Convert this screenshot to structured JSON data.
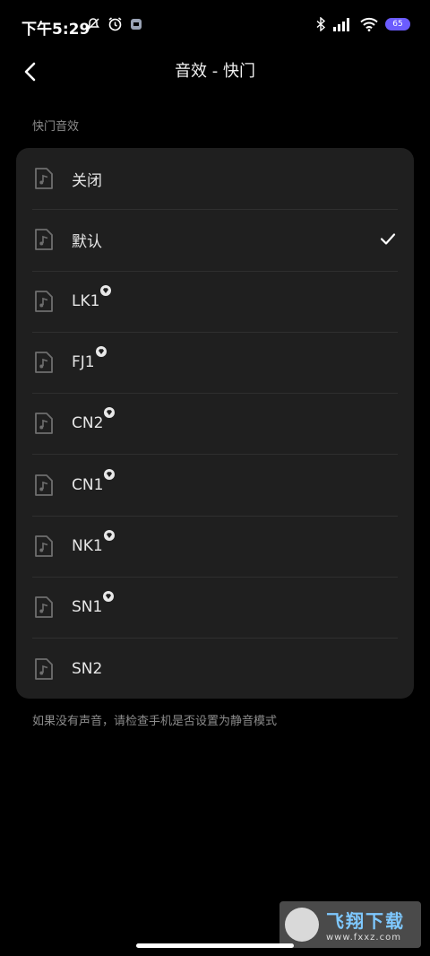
{
  "status_bar": {
    "time": "下午5:29",
    "battery": "65"
  },
  "header": {
    "title": "音效 - 快门"
  },
  "section_label": "快门音效",
  "options": [
    {
      "label": "关闭",
      "premium": false,
      "selected": false
    },
    {
      "label": "默认",
      "premium": false,
      "selected": true
    },
    {
      "label": "LK1",
      "premium": true,
      "selected": false
    },
    {
      "label": "FJ1",
      "premium": true,
      "selected": false
    },
    {
      "label": "CN2",
      "premium": true,
      "selected": false
    },
    {
      "label": "CN1",
      "premium": true,
      "selected": false
    },
    {
      "label": "NK1",
      "premium": true,
      "selected": false
    },
    {
      "label": "SN1",
      "premium": true,
      "selected": false
    },
    {
      "label": "SN2",
      "premium": false,
      "selected": false
    }
  ],
  "hint": "如果没有声音，请检查手机是否设置为静音模式",
  "watermark": {
    "name": "飞翔下载",
    "url": "www.fxxz.com"
  }
}
